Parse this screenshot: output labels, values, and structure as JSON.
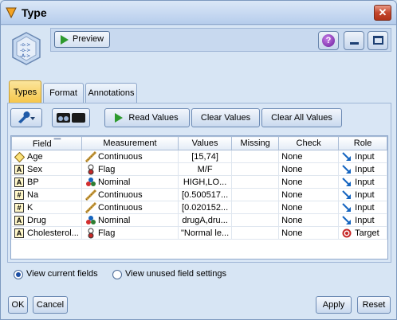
{
  "window": {
    "title": "Type"
  },
  "toolbar": {
    "preview_label": "Preview"
  },
  "tabs": [
    {
      "label": "Types",
      "active": true
    },
    {
      "label": "Format",
      "active": false
    },
    {
      "label": "Annotations",
      "active": false
    }
  ],
  "actions": {
    "read_values": "Read Values",
    "clear_values": "Clear Values",
    "clear_all_values": "Clear All Values"
  },
  "table": {
    "columns": [
      "Field",
      "Measurement",
      "Values",
      "Missing",
      "Check",
      "Role"
    ],
    "rows": [
      {
        "type_icon": "continuous-field-icon",
        "field": "Age",
        "measurement": "Continuous",
        "measurement_icon": "ruler-icon",
        "values": "[15,74]",
        "missing": "",
        "check": "None",
        "role": "Input",
        "role_icon": "input-arrow-icon"
      },
      {
        "type_icon": "string-field-icon",
        "field": "Sex",
        "measurement": "Flag",
        "measurement_icon": "flag-icon",
        "values": "M/F",
        "missing": "",
        "check": "None",
        "role": "Input",
        "role_icon": "input-arrow-icon"
      },
      {
        "type_icon": "string-field-icon",
        "field": "BP",
        "measurement": "Nominal",
        "measurement_icon": "nominal-icon",
        "values": "HIGH,LO...",
        "missing": "",
        "check": "None",
        "role": "Input",
        "role_icon": "input-arrow-icon"
      },
      {
        "type_icon": "real-field-icon",
        "field": "Na",
        "measurement": "Continuous",
        "measurement_icon": "ruler-icon",
        "values": "[0.500517...",
        "missing": "",
        "check": "None",
        "role": "Input",
        "role_icon": "input-arrow-icon"
      },
      {
        "type_icon": "real-field-icon",
        "field": "K",
        "measurement": "Continuous",
        "measurement_icon": "ruler-icon",
        "values": "[0.020152...",
        "missing": "",
        "check": "None",
        "role": "Input",
        "role_icon": "input-arrow-icon"
      },
      {
        "type_icon": "string-field-icon",
        "field": "Drug",
        "measurement": "Nominal",
        "measurement_icon": "nominal-icon",
        "values": "drugA,dru...",
        "missing": "",
        "check": "None",
        "role": "Input",
        "role_icon": "input-arrow-icon"
      },
      {
        "type_icon": "string-field-icon",
        "field": "Cholesterol...",
        "measurement": "Flag",
        "measurement_icon": "flag-icon",
        "values": "\"Normal le...",
        "missing": "",
        "check": "None",
        "role": "Target",
        "role_icon": "target-icon"
      }
    ]
  },
  "view_options": {
    "current_fields": "View current fields",
    "unused_settings": "View unused field settings",
    "selected": "current_fields"
  },
  "buttons": {
    "ok": "OK",
    "cancel": "Cancel",
    "apply": "Apply",
    "reset": "Reset"
  }
}
